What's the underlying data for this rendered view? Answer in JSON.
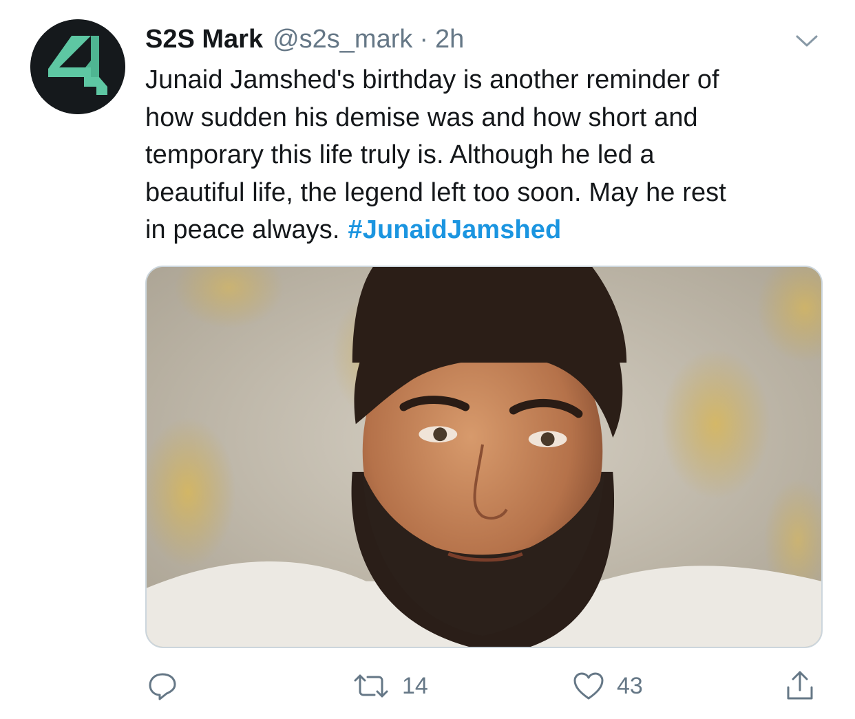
{
  "tweet": {
    "author": {
      "display_name": "S2S Mark",
      "handle": "@s2s_mark",
      "avatar_icon": "s2s-logo-four",
      "avatar_bg": "#15191c",
      "avatar_accent": "#5ec7a3"
    },
    "separator": "·",
    "time": "2h",
    "text_lines": [
      "Junaid Jamshed's birthday is another reminder of",
      "how sudden his demise was and how short and",
      "temporary this life truly is. Although he led a",
      "beautiful life, the legend left too soon. May he rest",
      "in peace always."
    ],
    "hashtag": "#JunaidJamshed",
    "hashtag_color": "#1b95e0",
    "media": {
      "type": "photo",
      "icon": "portrait-photo"
    },
    "actions": {
      "reply": {
        "icon": "reply-icon",
        "count": ""
      },
      "retweet": {
        "icon": "retweet-icon",
        "count": "14"
      },
      "like": {
        "icon": "heart-icon",
        "count": "43"
      },
      "share": {
        "icon": "share-icon",
        "count": ""
      }
    },
    "more_icon": "chevron-down-icon"
  }
}
